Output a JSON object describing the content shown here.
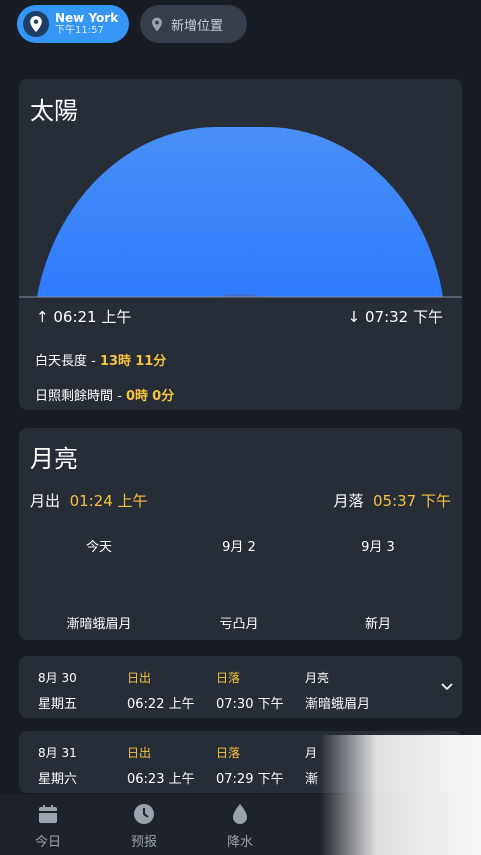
{
  "locations": [
    {
      "city": "New York",
      "time": "下午11:57",
      "active": true
    },
    {
      "label": "新增位置",
      "active": false
    }
  ],
  "sun": {
    "title": "太陽",
    "sunrise": "06:21 上午",
    "sunset": "07:32 下午",
    "daylength_label": "白天長度 -",
    "daylength_hours": "13時",
    "daylength_minutes": "11分",
    "remaining_label": "日照剩餘時間 -",
    "remaining_hours": "0時",
    "remaining_minutes": "0分",
    "arc_color": "#2f7bff"
  },
  "moon": {
    "title": "月亮",
    "moonrise_label": "月出",
    "moonrise": "01:24 上午",
    "moonset_label": "月落",
    "moonset": "05:37 下午",
    "days": [
      {
        "label": "今天",
        "phase": "漸暗蛾眉月"
      },
      {
        "label": "9月 2",
        "phase": "亏凸月"
      },
      {
        "label": "9月 3",
        "phase": "新月"
      }
    ]
  },
  "daily": [
    {
      "date": "8月 30",
      "weekday": "星期五",
      "sunrise_label": "日出",
      "sunrise": "06:22 上午",
      "sunset_label": "日落",
      "sunset": "07:30 下午",
      "moon_label": "月亮",
      "moon": "漸暗蛾眉月"
    },
    {
      "date": "8月 31",
      "weekday": "星期六",
      "sunrise_label": "日出",
      "sunrise": "06:23 上午",
      "sunset_label": "日落",
      "sunset": "07:29 下午",
      "moon_label": "月",
      "moon": "漸"
    }
  ],
  "nav": [
    {
      "label": "今日",
      "icon": "calendar-icon"
    },
    {
      "label": "预报",
      "icon": "clock-icon"
    },
    {
      "label": "降水",
      "icon": "water-drop-icon"
    }
  ],
  "colors": {
    "accent": "#3596f5",
    "highlight": "#f6c33f",
    "card": "#272d37",
    "background": "#181d25"
  }
}
